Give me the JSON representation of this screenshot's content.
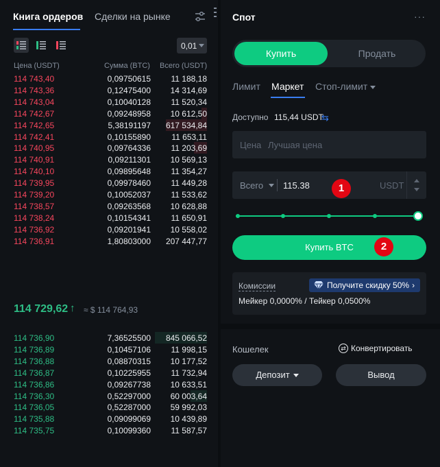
{
  "orderbook": {
    "tabs": [
      "Книга ордеров",
      "Сделки на рынке"
    ],
    "tick_size": "0,01",
    "columns": [
      "Цена (USDT)",
      "Сумма (BTC)",
      "Всего (USDT)"
    ],
    "asks": [
      {
        "price": "114 743,40",
        "amount": "0,09750615",
        "total": "11 188,18",
        "depth": 0.0
      },
      {
        "price": "114 743,36",
        "amount": "0,12475400",
        "total": "14 314,69",
        "depth": 0.0
      },
      {
        "price": "114 743,04",
        "amount": "0,10040128",
        "total": "11 520,34",
        "depth": 0.0
      },
      {
        "price": "114 742,67",
        "amount": "0,09248958",
        "total": "10 612,50",
        "depth": 0.1
      },
      {
        "price": "114 742,65",
        "amount": "5,38191197",
        "total": "617 534,84",
        "depth": 0.75
      },
      {
        "price": "114 742,41",
        "amount": "0,10155890",
        "total": "11 653,11",
        "depth": 0.0
      },
      {
        "price": "114 740,95",
        "amount": "0,09764336",
        "total": "11 203,69",
        "depth": 0.24
      },
      {
        "price": "114 740,91",
        "amount": "0,09211301",
        "total": "10 569,13",
        "depth": 0.0
      },
      {
        "price": "114 740,10",
        "amount": "0,09895648",
        "total": "11 354,27",
        "depth": 0.0
      },
      {
        "price": "114 739,95",
        "amount": "0,09978460",
        "total": "11 449,28",
        "depth": 0.0
      },
      {
        "price": "114 739,20",
        "amount": "0,10052037",
        "total": "11 533,62",
        "depth": 0.0
      },
      {
        "price": "114 738,57",
        "amount": "0,09263568",
        "total": "10 628,88",
        "depth": 0.0
      },
      {
        "price": "114 738,24",
        "amount": "0,10154341",
        "total": "11 650,91",
        "depth": 0.0
      },
      {
        "price": "114 736,92",
        "amount": "0,09201941",
        "total": "10 558,02",
        "depth": 0.0
      },
      {
        "price": "114 736,91",
        "amount": "1,80803000",
        "total": "207 447,77",
        "depth": 0.0
      }
    ],
    "last_price": "114 729,62",
    "last_arrow": "↑",
    "index_price": "≈ $ 114 764,93",
    "bids": [
      {
        "price": "114 736,90",
        "amount": "7,36525500",
        "total": "845 066,52",
        "depth": 0.95
      },
      {
        "price": "114 736,89",
        "amount": "0,10457106",
        "total": "11 998,15",
        "depth": 0.0
      },
      {
        "price": "114 736,88",
        "amount": "0,08870315",
        "total": "10 177,52",
        "depth": 0.0
      },
      {
        "price": "114 736,87",
        "amount": "0,10225955",
        "total": "11 732,94",
        "depth": 0.0
      },
      {
        "price": "114 736,86",
        "amount": "0,09267738",
        "total": "10 633,51",
        "depth": 0.0
      },
      {
        "price": "114 736,30",
        "amount": "0,52297000",
        "total": "60 003,64",
        "depth": 0.3
      },
      {
        "price": "114 736,05",
        "amount": "0,52287000",
        "total": "59 992,03",
        "depth": 0.0
      },
      {
        "price": "114 735,88",
        "amount": "0,09099069",
        "total": "10 439,89",
        "depth": 0.0
      },
      {
        "price": "114 735,75",
        "amount": "0,10099360",
        "total": "11 587,57",
        "depth": 0.0
      }
    ]
  },
  "spot": {
    "title": "Спот",
    "more": "···",
    "buy_tab": "Купить",
    "sell_tab": "Продать",
    "order_types": [
      "Лимит",
      "Маркет",
      "Стоп-лимит"
    ],
    "available_label": "Доступно",
    "available_value": "115,44 USDT",
    "price_label": "Цена",
    "price_placeholder": "Лучшая цена",
    "total_label": "Всего",
    "total_value": "115.38",
    "total_unit": "USDT",
    "slider_fraction": 1.0,
    "buy_button": "Купить BTC",
    "fees_label": "Комиссии",
    "fees_promo": "Получите скидку 50%",
    "fees_rates": "Мейкер 0,0000% / Тейкер 0,0500%",
    "badge_1": "1",
    "badge_2": "2"
  },
  "wallet": {
    "title": "Кошелек",
    "convert": "Конвертировать",
    "deposit": "Депозит",
    "withdraw": "Вывод"
  },
  "colors": {
    "ask": "#f6465d",
    "bid": "#2ebd85",
    "buy": "#0ecb81",
    "accent": "#3a7df0",
    "badge": "#e30613"
  }
}
